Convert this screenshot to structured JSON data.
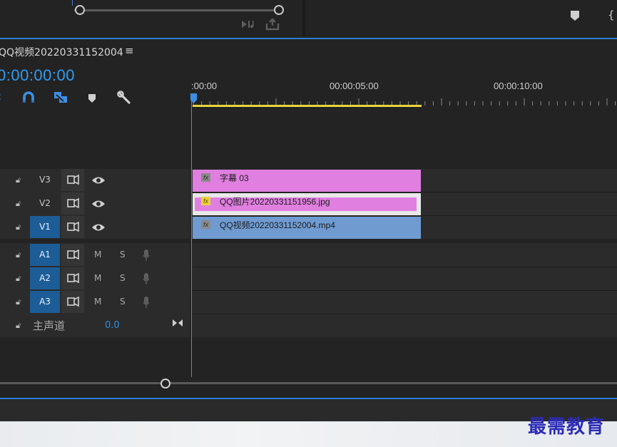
{
  "sequence": {
    "title": "QQ视频20220331152004",
    "menu_icon": "hamburger-icon",
    "timecode": "0:00:00:00"
  },
  "ruler": {
    "labels": [
      ":00:00",
      "00:00:05:00",
      "00:00:10:00"
    ]
  },
  "tracks": {
    "video": [
      {
        "name": "V3",
        "targeted": false
      },
      {
        "name": "V2",
        "targeted": false
      },
      {
        "name": "V1",
        "targeted": true
      }
    ],
    "audio": [
      {
        "name": "A1",
        "m": "M",
        "s": "S"
      },
      {
        "name": "A2",
        "m": "M",
        "s": "S"
      },
      {
        "name": "A3",
        "m": "M",
        "s": "S"
      }
    ],
    "master": {
      "name": "主声道",
      "value": "0.0"
    }
  },
  "clips": {
    "v3": {
      "label": "字幕 03",
      "fx": "fx",
      "color": "#e07fe0"
    },
    "v2": {
      "label": "QQ图片20220331151956.jpg",
      "fx": "fx",
      "color": "#e07fe0"
    },
    "v1": {
      "label": "QQ视频20220331152004.mp4",
      "fx": "fx",
      "color": "#6f9bd1"
    }
  },
  "colors": {
    "accent_blue": "#2f9bf0",
    "work_area": "#e6d43a",
    "targeted_track": "#1d5d97"
  },
  "watermark": "最需教育"
}
